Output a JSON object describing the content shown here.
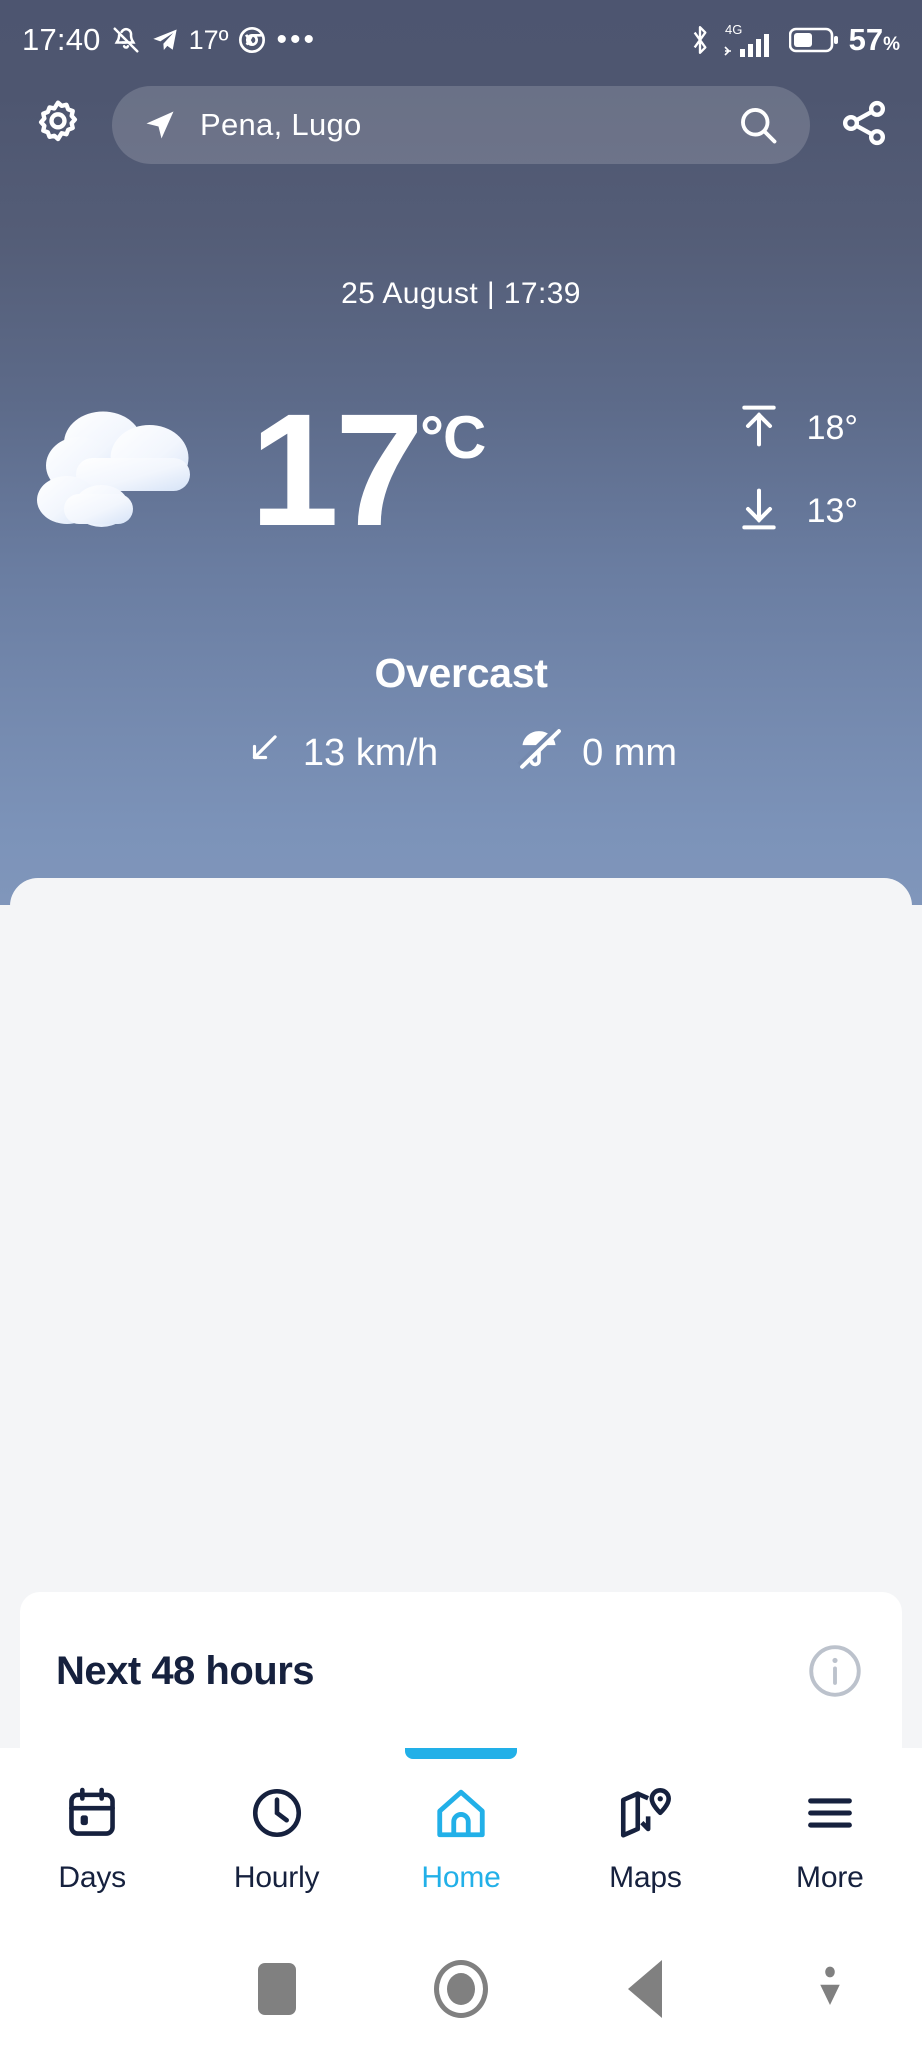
{
  "statusbar": {
    "clock": "17:40",
    "mute_icon": "bell-muted-icon",
    "telegram_icon": "telegram-icon",
    "temp": "17º",
    "chrome_icon": "chrome-icon",
    "overflow": "•••",
    "bluetooth_icon": "bluetooth-icon",
    "network_label": "4G",
    "signal_icon": "signal-bars-icon",
    "battery_icon": "battery-icon",
    "battery_pct": "57",
    "battery_pct_unit": "%"
  },
  "topbar": {
    "settings_icon": "gear-icon",
    "location_icon": "navigation-arrow-icon",
    "location_name": "Pena, Lugo",
    "search_icon": "search-icon",
    "share_icon": "share-icon"
  },
  "current": {
    "datetime": "25 August | 17:39",
    "weather_icon": "cloudy-icon",
    "temperature": "17",
    "unit": "°C",
    "high_icon": "arrow-up-icon",
    "high": "18°",
    "low_icon": "arrow-down-icon",
    "low": "13°",
    "condition": "Overcast",
    "wind_icon": "wind-direction-southwest-icon",
    "wind": "13 km/h",
    "precip_icon": "umbrella-off-icon",
    "precip": "0 mm"
  },
  "forecast_card": {
    "title": "Next 48 hours",
    "info_icon": "info-icon"
  },
  "tabs": [
    {
      "label": "Days",
      "icon": "calendar-icon",
      "active": false
    },
    {
      "label": "Hourly",
      "icon": "clock-icon",
      "active": false
    },
    {
      "label": "Home",
      "icon": "home-icon",
      "active": true
    },
    {
      "label": "Maps",
      "icon": "map-pin-icon",
      "active": false
    },
    {
      "label": "More",
      "icon": "menu-icon",
      "active": false
    }
  ],
  "navbar": {
    "recents_icon": "recents-square-icon",
    "home_icon": "home-circle-icon",
    "back_icon": "back-triangle-icon",
    "keyboard_icon": "hide-keyboard-icon"
  },
  "colors": {
    "accent": "#22b0e8",
    "text_dark": "#16213e",
    "sheet_bg": "#f4f5f7",
    "gradient_top": "#4d5570",
    "gradient_bottom": "#8096bb"
  }
}
